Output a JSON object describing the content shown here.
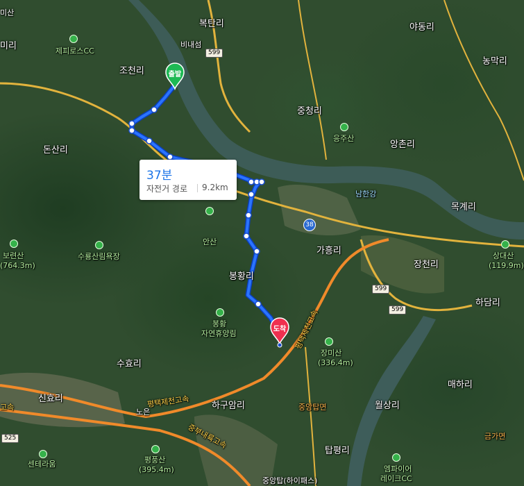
{
  "route": {
    "time": "37분",
    "mode": "자전거 경로",
    "distance": "9.2km",
    "start_label": "출발",
    "end_label": "도착"
  },
  "labels": {
    "bidaeseom": "비내섬",
    "bokpyeongri": "복탄리",
    "yadongri": "야동리",
    "nonmakri": "농막리",
    "jecheonri_top": "미리",
    "jehp": "제피로스CC",
    "jochonri": "조천리",
    "jungcheongri": "중청리",
    "eungjusan": "응주산",
    "angchonri": "앙촌리",
    "donsanri": "돈산리",
    "namhangang": "남한강",
    "mokgyeri": "목계리",
    "boryeonsan": "보련산",
    "boryeonsan_h": "(764.3m)",
    "anshan": "안산",
    "suryong": "수룡산림욕장",
    "gaheungri": "가흥리",
    "jangcheonri": "장천리",
    "sangdaesan": "상대산",
    "sangdaesan_h": "(119.9m)",
    "bonghwangri": "봉황리",
    "hadamri": "하담리",
    "bonghwang_forest1": "봉황",
    "bonghwang_forest2": "자연휴양림",
    "jangmisan": "장미산",
    "jangmisan_h": "(336.4m)",
    "suhyori": "수효리",
    "maehari": "매하리",
    "sinhyori": "신효리",
    "hagamri": "하구암리",
    "joonganghap": "중앙탑면",
    "wolsangri": "월상리",
    "geumgamyeon": "금가면",
    "noeun": "노은",
    "centella": "센테라움",
    "pyeongsan": "평풍산",
    "pyeongsan_h": "(395.4m)",
    "tappyeongri": "탑평리",
    "empire1": "엠파이어",
    "empire2": "레이크CC",
    "jungang_ic": "중앙탑(하이패스)",
    "misan": "미산",
    "road_pyeongtaek": "평택제천고속",
    "road_pyeongtaek2": "평택제천고속",
    "road_jungbu": "중부내륙고속",
    "road_jungbu_v": "중부내륙고속",
    "road_sinhyo": "고속"
  },
  "shields": {
    "r599a": "599",
    "r599b": "599",
    "r599c": "599",
    "r38": "38",
    "r525": "525"
  }
}
